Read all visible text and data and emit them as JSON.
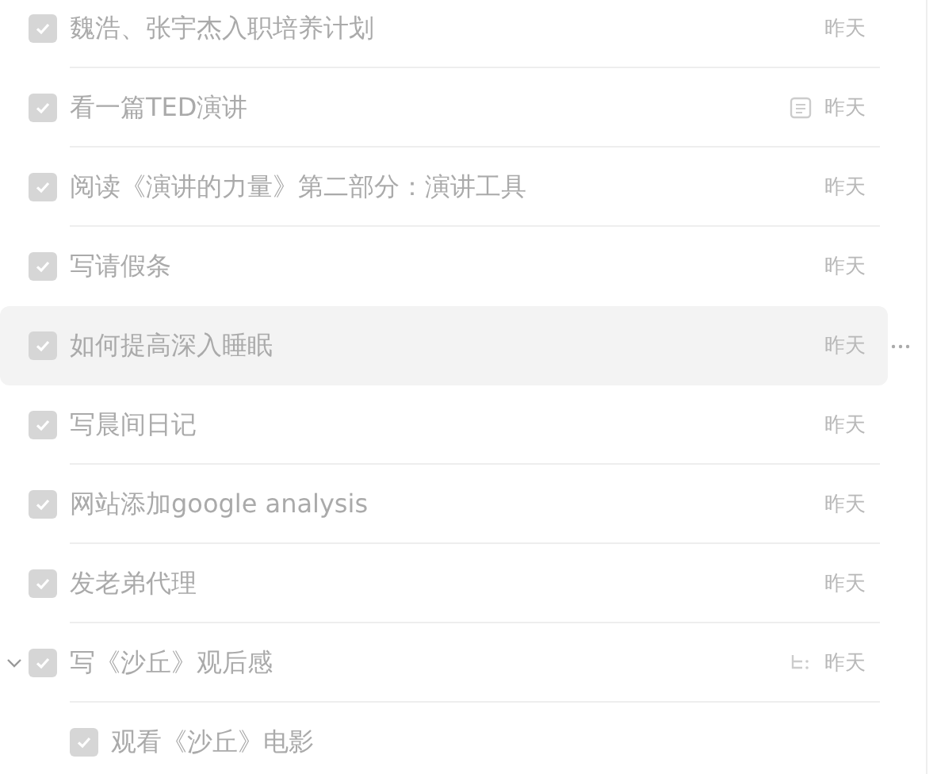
{
  "tasks": [
    {
      "title": "魏浩、张宇杰入职培养计划",
      "date": "昨天",
      "checked": true,
      "selected": false,
      "has_note": false
    },
    {
      "title": "看一篇TED演讲",
      "date": "昨天",
      "checked": true,
      "selected": false,
      "has_note": true
    },
    {
      "title": "阅读《演讲的力量》第二部分：演讲工具",
      "date": "昨天",
      "checked": true,
      "selected": false,
      "has_note": false
    },
    {
      "title": "写请假条",
      "date": "昨天",
      "checked": true,
      "selected": false,
      "has_note": false
    },
    {
      "title": "如何提高深入睡眠",
      "date": "昨天",
      "checked": true,
      "selected": true,
      "has_note": false
    },
    {
      "title": "写晨间日记",
      "date": "昨天",
      "checked": true,
      "selected": false,
      "has_note": false
    },
    {
      "title": "网站添加google analysis",
      "date": "昨天",
      "checked": true,
      "selected": false,
      "has_note": false
    },
    {
      "title": "发老弟代理",
      "date": "昨天",
      "checked": true,
      "selected": false,
      "has_note": false
    },
    {
      "title": "写《沙丘》观后感",
      "date": "昨天",
      "checked": true,
      "selected": false,
      "has_note": false,
      "expanded": true,
      "children": [
        {
          "title": "观看《沙丘》电影",
          "checked": true,
          "selected": false,
          "has_note": false
        }
      ]
    }
  ]
}
